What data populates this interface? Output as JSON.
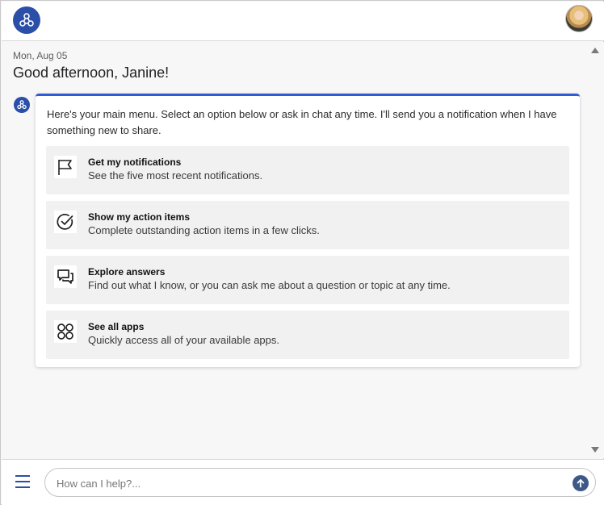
{
  "header": {
    "logo_icon": "connection-nodes-icon",
    "avatar_icon": "user-avatar"
  },
  "chat": {
    "date": "Mon, Aug 05",
    "greeting": "Good afternoon, Janine!",
    "bot_icon": "connection-nodes-icon",
    "card": {
      "accent_color": "#2e5ad6",
      "intro": "Here's your main menu. Select an option below or ask in chat any time. I'll send you a notification when I have something new to share.",
      "options": [
        {
          "icon": "flag-icon",
          "title": "Get my notifications",
          "description": "See the five most recent notifications."
        },
        {
          "icon": "check-circle-icon",
          "title": "Show my action items",
          "description": "Complete outstanding action items in a few clicks."
        },
        {
          "icon": "chat-bubbles-icon",
          "title": "Explore answers",
          "description": "Find out what I know, or you can ask me about a question or topic at any time."
        },
        {
          "icon": "apps-grid-icon",
          "title": "See all apps",
          "description": "Quickly access all of your available apps."
        }
      ]
    }
  },
  "composer": {
    "menu_icon": "hamburger-menu-icon",
    "input_value": "",
    "input_placeholder": "How can I help?...",
    "send_icon": "send-arrow-icon"
  },
  "colors": {
    "brand": "#2b4fa8",
    "accent": "#2e5ad6",
    "send_button": "#3d5a87"
  }
}
